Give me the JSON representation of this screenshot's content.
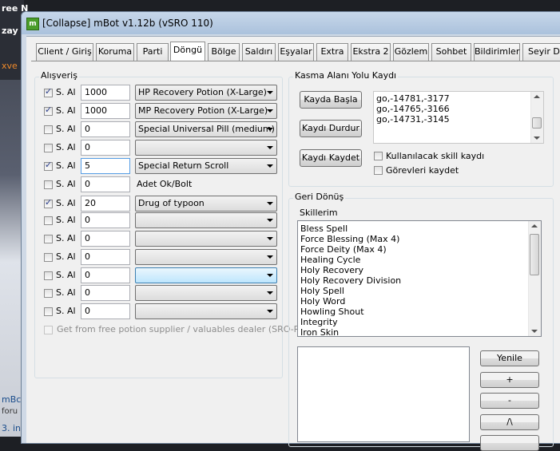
{
  "background": {
    "texts": [
      "ree N",
      "zay",
      "xve",
      "mBc",
      "foru",
      "3. in"
    ]
  },
  "window": {
    "title": "[Collapse] mBot v1.12b (vSRO 110)",
    "icon": "app-icon"
  },
  "tabs": [
    {
      "label": "Client / Giriş",
      "active": false
    },
    {
      "label": "Koruma",
      "active": false
    },
    {
      "label": "Parti",
      "active": false
    },
    {
      "label": "Döngü",
      "active": true
    },
    {
      "label": "Bölge",
      "active": false
    },
    {
      "label": "Saldırı",
      "active": false
    },
    {
      "label": "Eşyalar",
      "active": false
    },
    {
      "label": "Extra",
      "active": false
    },
    {
      "label": "Ekstra 2",
      "active": false
    },
    {
      "label": "Gözlem",
      "active": false
    },
    {
      "label": "Sohbet",
      "active": false
    },
    {
      "label": "Bildirimler",
      "active": false
    },
    {
      "label": "Seyir Def",
      "active": false
    }
  ],
  "shopping": {
    "title": "Alışveriş",
    "rows": [
      {
        "checked": true,
        "label": "S. Al",
        "qty": "1000",
        "item": "HP Recovery Potion (X-Large)"
      },
      {
        "checked": true,
        "label": "S. Al",
        "qty": "1000",
        "item": "MP Recovery Potion (X-Large)"
      },
      {
        "checked": false,
        "label": "S. Al",
        "qty": "0",
        "item": "Special Universal Pill (medium)"
      },
      {
        "checked": false,
        "label": "S. Al",
        "qty": "0",
        "item": ""
      },
      {
        "checked": true,
        "label": "S. Al",
        "qty": "5",
        "item": "Special Return Scroll"
      },
      {
        "checked": false,
        "label": "S. Al",
        "qty": "0",
        "item": "",
        "note": "Adet Ok/Bolt"
      },
      {
        "checked": true,
        "label": "S. Al",
        "qty": "20",
        "item": "Drug of typoon"
      },
      {
        "checked": false,
        "label": "S. Al",
        "qty": "0",
        "item": ""
      },
      {
        "checked": false,
        "label": "S. Al",
        "qty": "0",
        "item": ""
      },
      {
        "checked": false,
        "label": "S. Al",
        "qty": "0",
        "item": ""
      },
      {
        "checked": false,
        "label": "S. Al",
        "qty": "0",
        "item": ""
      },
      {
        "checked": false,
        "label": "S. Al",
        "qty": "0",
        "item": ""
      },
      {
        "checked": false,
        "label": "S. Al",
        "qty": "0",
        "item": ""
      }
    ],
    "free_potion_label": "Get from free potion supplier / valuables dealer (SRO-R)"
  },
  "recording": {
    "title": "Kasma Alanı Yolu Kaydı",
    "start_label": "Kayda Başla",
    "stop_label": "Kaydı Durdur",
    "save_label": "Kaydı Kaydet",
    "coords": [
      "go,-14781,-3177",
      "go,-14765,-3166",
      "go,-14731,-3145"
    ],
    "use_skill_label": "Kullanılacak skill kaydı",
    "save_tasks_label": "Görevleri kaydet"
  },
  "return": {
    "title": "Geri Dönüş",
    "skills_label": "Skillerim",
    "skills": [
      "Bless Spell",
      "Force Blessing (Max 4)",
      "Force Deity (Max 4)",
      "Healing Cycle",
      "Holy Recovery",
      "Holy Recovery Division",
      "Holy Spell",
      "Holy Word",
      "Howling Shout",
      "Integrity",
      "Iron Skin"
    ],
    "refresh_label": "Yenile",
    "add_label": "+",
    "remove_label": "-",
    "up_label": "/\\"
  }
}
